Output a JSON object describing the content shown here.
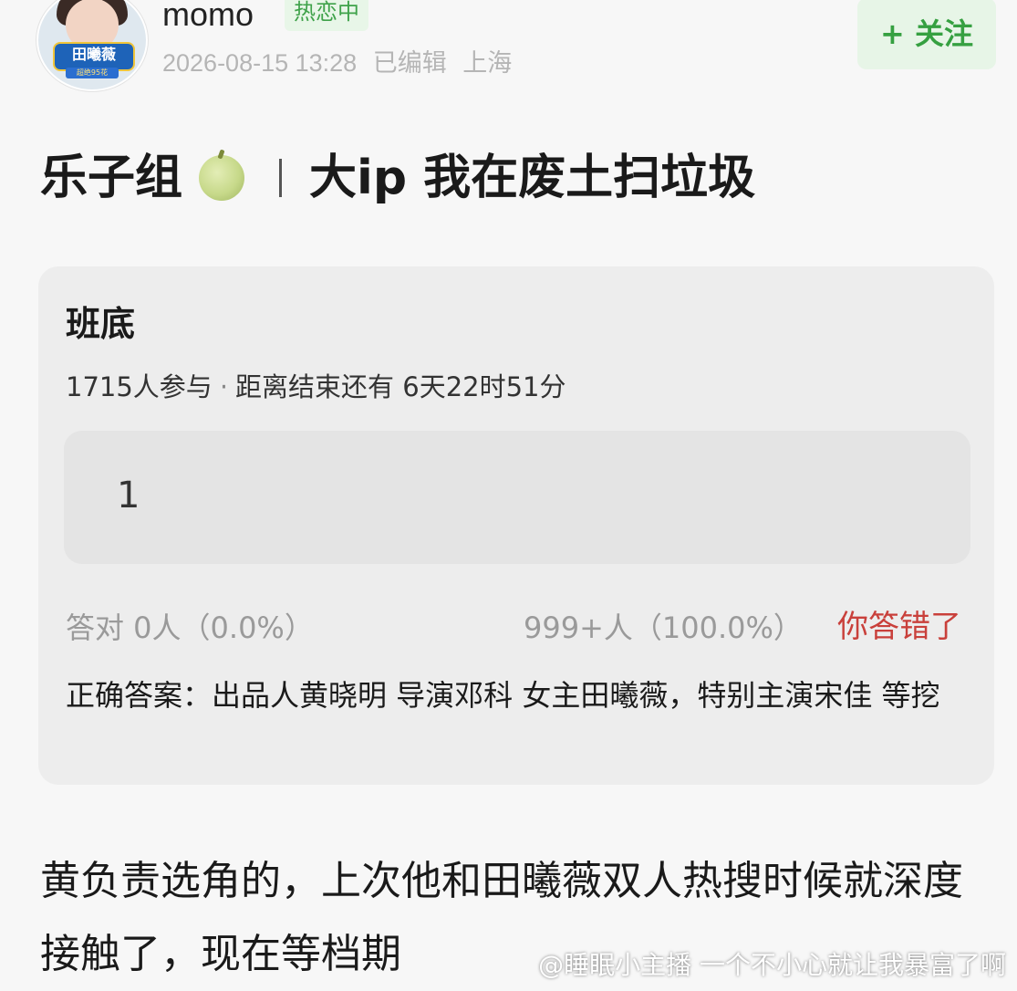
{
  "author": {
    "avatar_tag": "田曦薇",
    "avatar_subtag": "超绝95花",
    "username": "momo",
    "status_badge": "热恋中",
    "timestamp": "2026-08-15 13:28",
    "edited": "已编辑",
    "location": "上海",
    "follow_label": "+ 关注"
  },
  "post": {
    "group": "乐子组",
    "emoji": "melon-icon",
    "title": "大ip 我在废土扫垃圾"
  },
  "quiz": {
    "title": "班底",
    "participants": "1715人参与",
    "separator": "·",
    "deadline": "距离结束还有 6天22时51分",
    "my_answer": "1",
    "correct_stat": "答对  0人（0.0%）",
    "wrong_stat": "999+人（100.0%）",
    "result_label": "你答错了",
    "correct_answer": "正确答案：出品人黄晓明 导演邓科 女主田曦薇，特别主演宋佳 等挖"
  },
  "body": {
    "text": "黄负责选角的，上次他和田曦薇双人热搜时候就深度接触了，现在等档期"
  },
  "watermark": "@睡眠小主播 一个不小心就让我暴富了啊",
  "colors": {
    "accent_green": "#36a041",
    "error_red": "#c9403b",
    "card_bg": "#ededed"
  }
}
